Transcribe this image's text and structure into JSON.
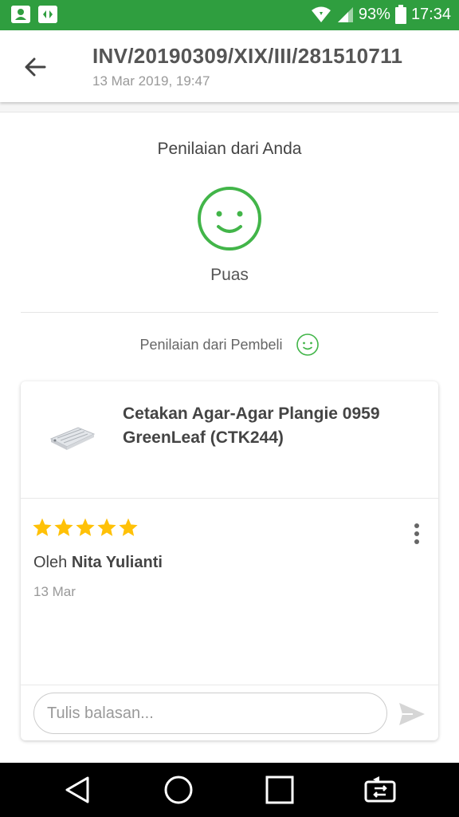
{
  "status_bar": {
    "battery": "93%",
    "time": "17:34",
    "icons": [
      "contact-card-icon",
      "diamond-app-icon",
      "wifi-icon",
      "signal-icon",
      "battery-icon"
    ]
  },
  "header": {
    "title": "INV/20190309/XIX/III/281510711",
    "subtitle": "13 Mar 2019, 19:47",
    "back_icon": "arrow-left-icon"
  },
  "rating_from_you": {
    "heading": "Penilaian dari Anda",
    "icon": "smiley-icon",
    "label": "Puas"
  },
  "rating_from_buyer": {
    "label": "Penilaian dari Pembeli",
    "icon": "smiley-icon"
  },
  "review_card": {
    "product_name": "Cetakan Agar-Agar Plangie 0959 GreenLeaf (CTK244)",
    "stars": 5,
    "by_prefix": "Oleh",
    "reviewer_name": "Nita Yulianti",
    "date": "13 Mar",
    "reply_placeholder": "Tulis balasan...",
    "reply_value": ""
  },
  "colors": {
    "status_bar": "#2f9e3f",
    "accent_green": "#42b549",
    "star": "#ffc107"
  },
  "nav_bar": {
    "buttons": [
      "back-triangle-icon",
      "home-circle-icon",
      "recents-square-icon",
      "screen-rotate-icon"
    ]
  }
}
